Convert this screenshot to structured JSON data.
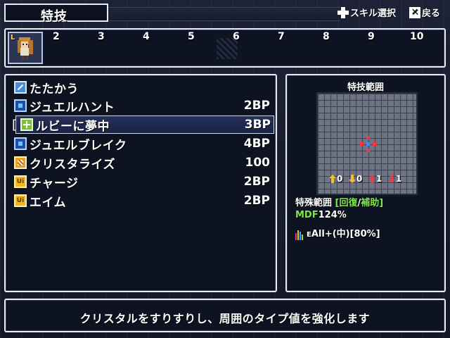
{
  "header": {
    "title": "特技",
    "hint_select": "スキル選択",
    "hint_back": "戻る",
    "hint_select_icon": "dpad-icon",
    "hint_back_icon": "x-button-icon"
  },
  "slots": {
    "level_badge": "L",
    "numbers": [
      "2",
      "3",
      "4",
      "5",
      "6",
      "7",
      "8",
      "9",
      "10"
    ]
  },
  "skills": [
    {
      "name": "たたかう",
      "cost": "",
      "icon": "sword-icon"
    },
    {
      "name": "ジュエルハント",
      "cost": "2BP",
      "icon": "jewel-icon"
    },
    {
      "name": "ルビーに夢中",
      "cost": "3BP",
      "icon": "heal-plus-icon",
      "selected": true
    },
    {
      "name": "ジュエルブレイク",
      "cost": "4BP",
      "icon": "jewel-icon"
    },
    {
      "name": "クリスタライズ",
      "cost": "100",
      "icon": "crystal-icon"
    },
    {
      "name": "チャージ",
      "cost": "2BP",
      "icon": "buff-icon"
    },
    {
      "name": "エイム",
      "cost": "2BP",
      "icon": "buff-icon"
    }
  ],
  "range": {
    "title": "特技範囲",
    "stats": [
      {
        "value": "0",
        "arrow": "up",
        "color": "#f0c030"
      },
      {
        "value": "0",
        "arrow": "down",
        "color": "#f0c030"
      },
      {
        "value": "1",
        "arrow": "up",
        "color": "#e04050"
      },
      {
        "value": "1",
        "arrow": "down",
        "color": "#e04050"
      }
    ],
    "special_label": "特殊範囲",
    "special_open": "[",
    "special_a": "回復",
    "special_sep": "/",
    "special_b": "補助",
    "special_close": "]",
    "mdf_label": "MDF",
    "mdf_value": "124%",
    "effect": "All+(中)[80%]",
    "effect_prefix": "E"
  },
  "description": "クリスタルをすりすりし、周囲のタイプ値を強化します"
}
